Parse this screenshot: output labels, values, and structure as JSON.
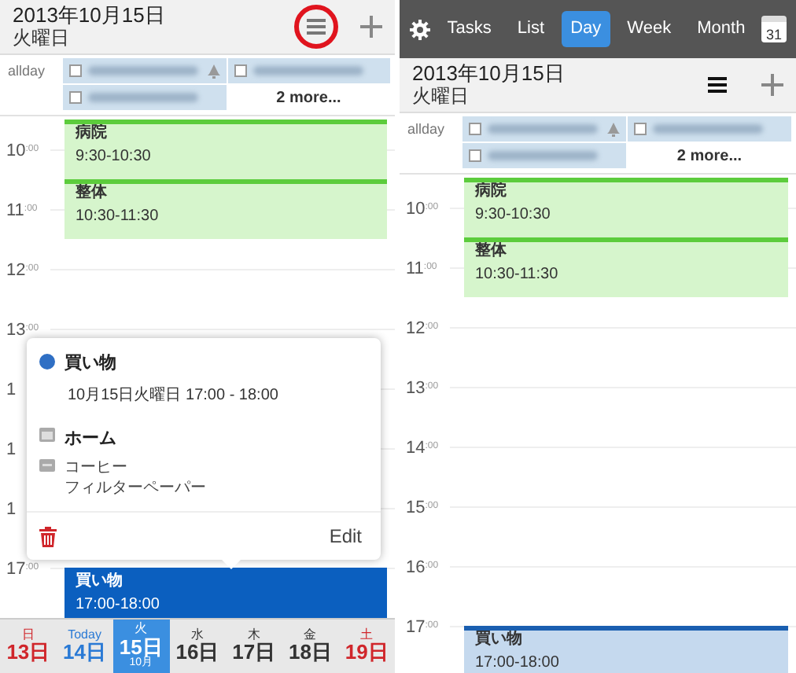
{
  "panels": [
    {
      "header": {
        "date": "2013年10月15日",
        "weekday": "火曜日",
        "menu_highlighted": true
      },
      "allday": {
        "label": "allday",
        "items": [
          {
            "checked": false,
            "alarm": true
          },
          {
            "checked": false,
            "alarm": false
          },
          {
            "checked": false,
            "alarm": false
          }
        ],
        "more": "2 more..."
      },
      "hours": [
        {
          "label": "10",
          "minutes": ":00"
        },
        {
          "label": "11",
          "minutes": ":00"
        },
        {
          "label": "12",
          "minutes": ":00"
        },
        {
          "label": "13",
          "minutes": ":00"
        },
        {
          "label": "1"
        },
        {
          "label": "1"
        },
        {
          "label": "1"
        },
        {
          "label": "17",
          "minutes": ":00"
        }
      ],
      "events": [
        {
          "title": "病院",
          "time": "9:30-10:30",
          "kind": "green",
          "selected": false
        },
        {
          "title": "整体",
          "time": "10:30-11:30",
          "kind": "green",
          "selected": false
        },
        {
          "title": "買い物",
          "time": "17:00-18:00",
          "kind": "blue",
          "selected": true
        }
      ],
      "popover": {
        "title": "買い物",
        "color": "#2f6fc4",
        "datetime": "10月15日火曜日 17:00 - 18:00",
        "calendar": "ホーム",
        "notes": [
          "コーヒー",
          "フィルターペーパー"
        ],
        "edit": "Edit"
      },
      "day_strip": [
        {
          "weekday": "日",
          "day": "13日",
          "kind": "sunday",
          "selected": false
        },
        {
          "weekday": "Today",
          "day": "14日",
          "kind": "today",
          "selected": false
        },
        {
          "weekday": "火",
          "day": "15日",
          "month": "10月",
          "kind": "weekday",
          "selected": true
        },
        {
          "weekday": "水",
          "day": "16日",
          "kind": "weekday",
          "selected": false
        },
        {
          "weekday": "木",
          "day": "17日",
          "kind": "weekday",
          "selected": false
        },
        {
          "weekday": "金",
          "day": "18日",
          "kind": "weekday",
          "selected": false
        },
        {
          "weekday": "土",
          "day": "19日",
          "kind": "saturday",
          "selected": false
        }
      ]
    },
    {
      "nav": {
        "tabs": [
          {
            "label": "Tasks",
            "selected": false
          },
          {
            "label": "List",
            "selected": false
          },
          {
            "label": "Day",
            "selected": true
          },
          {
            "label": "Week",
            "selected": false
          },
          {
            "label": "Month",
            "selected": false
          }
        ],
        "calendar_day": "31"
      },
      "header": {
        "date": "2013年10月15日",
        "weekday": "火曜日",
        "menu_highlighted": false
      },
      "allday": {
        "label": "allday",
        "items": [
          {
            "checked": false,
            "alarm": true
          },
          {
            "checked": false,
            "alarm": false
          },
          {
            "checked": false,
            "alarm": false
          }
        ],
        "more": "2 more..."
      },
      "hours": [
        {
          "label": "10",
          "minutes": ":00"
        },
        {
          "label": "11",
          "minutes": ":00"
        },
        {
          "label": "12",
          "minutes": ":00"
        },
        {
          "label": "13",
          "minutes": ":00"
        },
        {
          "label": "14",
          "minutes": ":00"
        },
        {
          "label": "15",
          "minutes": ":00"
        },
        {
          "label": "16",
          "minutes": ":00"
        },
        {
          "label": "17",
          "minutes": ":00"
        }
      ],
      "events": [
        {
          "title": "病院",
          "time": "9:30-10:30",
          "kind": "green",
          "selected": false
        },
        {
          "title": "整体",
          "time": "10:30-11:30",
          "kind": "green",
          "selected": false
        },
        {
          "title": "買い物",
          "time": "17:00-18:00",
          "kind": "blue",
          "selected": false
        }
      ]
    }
  ]
}
